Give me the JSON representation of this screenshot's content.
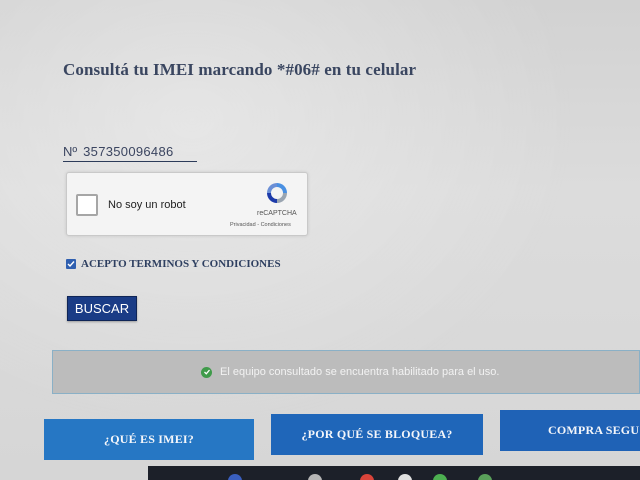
{
  "header": {
    "title": "Consultá tu IMEI marcando *#06# en tu celular"
  },
  "imei": {
    "prefix": "Nº",
    "value": "357350096486"
  },
  "captcha": {
    "label": "No soy un robot",
    "brand": "reCAPTCHA",
    "links": "Privacidad - Condiciones"
  },
  "terms": {
    "label": "ACEPTO TERMINOS Y CONDICIONES",
    "checked": true
  },
  "actions": {
    "search_label": "BUSCAR"
  },
  "result": {
    "message": "El equipo consultado se encuentra habilitado para el uso.",
    "status_color": "#3f9b4a"
  },
  "nav": {
    "items": [
      {
        "label": "¿QUÉ ES IMEI?"
      },
      {
        "label": "¿POR QUÉ SE BLOQUEA?"
      },
      {
        "label": "COMPRA SEGU"
      }
    ]
  },
  "colors": {
    "primary_button": "#1a3c86",
    "nav_button": "#2677c4"
  }
}
